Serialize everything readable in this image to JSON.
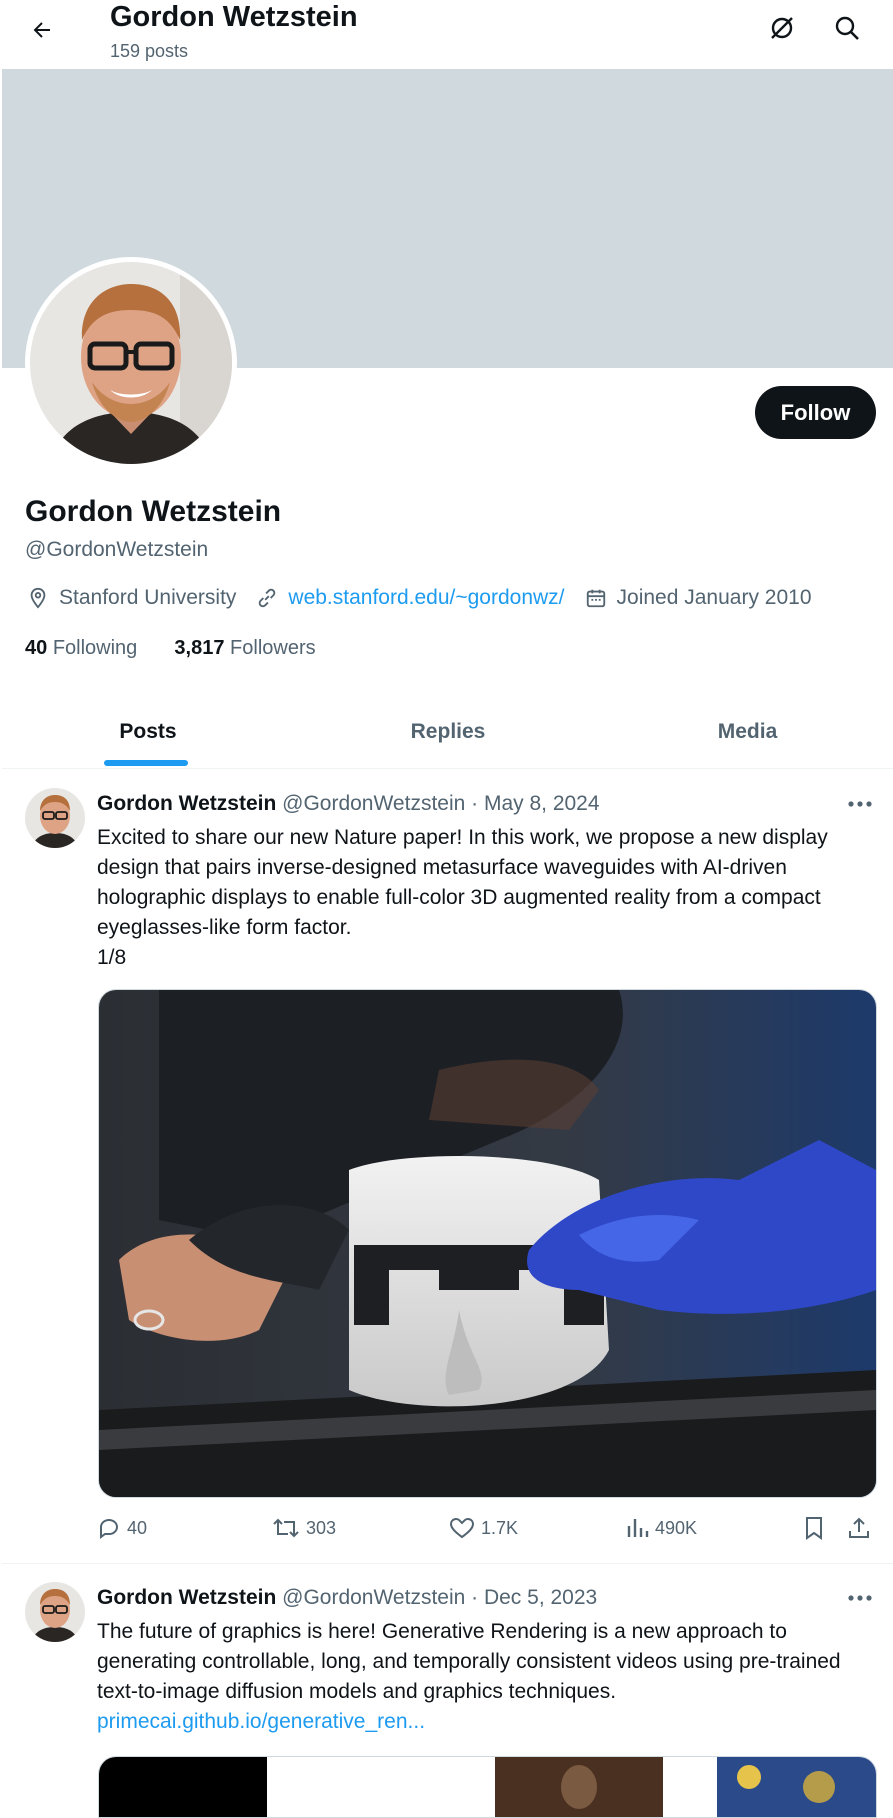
{
  "header": {
    "name": "Gordon Wetzstein",
    "posts_count": "159 posts"
  },
  "profile": {
    "name": "Gordon Wetzstein",
    "handle": "@GordonWetzstein",
    "location": "Stanford University",
    "website": "web.stanford.edu/~gordonwz/",
    "joined": "Joined January 2010",
    "following_count": "40",
    "following_label": "Following",
    "followers_count": "3,817",
    "followers_label": "Followers",
    "follow_button": "Follow"
  },
  "tabs": [
    {
      "label": "Posts",
      "active": true
    },
    {
      "label": "Replies",
      "active": false
    },
    {
      "label": "Media",
      "active": false
    }
  ],
  "tweets": [
    {
      "author": "Gordon Wetzstein",
      "meta": "@GordonWetzstein · May 8, 2024",
      "text": "Excited to share our new Nature paper! In this work, we propose a new display design that pairs inverse-designed metasurface waveguides with AI-driven holographic displays to enable full-color 3D augmented reality from a compact eyeglasses-like form factor.",
      "text2": "1/8",
      "replies": "40",
      "reposts": "303",
      "likes": "1.7K",
      "views": "490K"
    },
    {
      "author": "Gordon Wetzstein",
      "meta": "@GordonWetzstein · Dec 5, 2023",
      "text": "The future of graphics is here! Generative Rendering is a new approach to generating controllable, long, and temporally consistent videos using pre-trained text-to-image diffusion models and graphics techniques.",
      "link": "primecai.github.io/generative_ren..."
    }
  ],
  "colors": {
    "accent": "#1d9bf0",
    "banner": "#cfd9de",
    "text": "#0f1419",
    "muted": "#536471"
  },
  "icons": [
    "back-arrow-icon",
    "grok-icon",
    "search-icon",
    "location-icon",
    "link-icon",
    "calendar-icon",
    "more-icon",
    "reply-icon",
    "repost-icon",
    "like-icon",
    "views-icon",
    "bookmark-icon",
    "share-icon"
  ]
}
